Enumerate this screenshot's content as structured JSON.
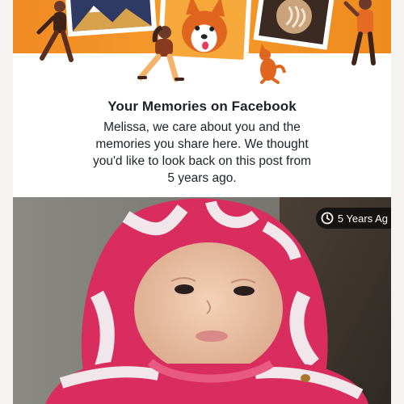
{
  "memory_card": {
    "title": "Your Memories on Facebook",
    "body_lines": [
      "Melissa, we care about you and the",
      "memories you share here. We thought",
      "you'd like to look back on this post from",
      "5 years ago."
    ]
  },
  "photo": {
    "timestamp_label": "5 Years Ag",
    "timestamp_icon": "clock-icon"
  },
  "colors": {
    "banner_orange": "#f08a22",
    "text_dark": "#1d2129",
    "hoodie_pink": "#d92d5f",
    "badge_bg": "#0f0f0f"
  }
}
